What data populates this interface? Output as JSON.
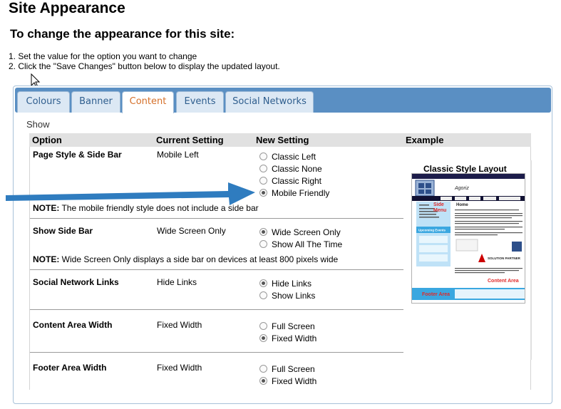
{
  "page": {
    "title": "Site Appearance",
    "subtitle": "To change the appearance for this site:",
    "instructions": [
      "1. Set the value for the option you want to change",
      "2. Click the \"Save Changes\" button below to display the updated layout."
    ]
  },
  "tabs": [
    {
      "label": "Colours",
      "active": false
    },
    {
      "label": "Banner",
      "active": false
    },
    {
      "label": "Content",
      "active": true
    },
    {
      "label": "Events",
      "active": false
    },
    {
      "label": "Social Networks",
      "active": false
    }
  ],
  "show_label": "Show",
  "table": {
    "headers": {
      "option": "Option",
      "current": "Current Setting",
      "new": "New Setting",
      "example": "Example"
    },
    "rows": [
      {
        "option": "Page Style & Side Bar",
        "current": "Mobile Left",
        "choices": [
          {
            "label": "Classic Left",
            "selected": false
          },
          {
            "label": "Classic None",
            "selected": false
          },
          {
            "label": "Classic Right",
            "selected": false
          },
          {
            "label": "Mobile Friendly",
            "selected": true
          }
        ],
        "note_label": "NOTE:",
        "note_text": " The mobile friendly style does not include a side bar"
      },
      {
        "option": "Show Side Bar",
        "current": "Wide Screen Only",
        "choices": [
          {
            "label": "Wide Screen Only",
            "selected": true
          },
          {
            "label": "Show All The Time",
            "selected": false
          }
        ],
        "note_label": "NOTE:",
        "note_text": " Wide Screen Only displays a side bar on devices at least 800 pixels wide"
      },
      {
        "option": "Social Network Links",
        "current": "Hide Links",
        "choices": [
          {
            "label": "Hide Links",
            "selected": true
          },
          {
            "label": "Show Links",
            "selected": false
          }
        ]
      },
      {
        "option": "Content Area Width",
        "current": "Fixed Width",
        "choices": [
          {
            "label": "Full Screen",
            "selected": false
          },
          {
            "label": "Fixed Width",
            "selected": true
          }
        ]
      },
      {
        "option": "Footer Area Width",
        "current": "Fixed Width",
        "choices": [
          {
            "label": "Full Screen",
            "selected": false
          },
          {
            "label": "Fixed Width",
            "selected": true
          }
        ]
      }
    ]
  },
  "example": {
    "title": "Classic Style Layout",
    "preview": {
      "home": "Home",
      "side_menu_1": "Side",
      "side_menu_2": "Menu",
      "upcoming": "Upcoming Events",
      "partner": "SOLUTION PARTNER",
      "content_area": "Content Area",
      "footer_area": "Footer Area"
    }
  },
  "colors": {
    "tab_bar": "#5a8fc3",
    "active_tab_text": "#d5702a",
    "arrow": "#2f7cbf",
    "preview_red": "#e02a2a",
    "preview_blue": "#3aa7e0"
  }
}
